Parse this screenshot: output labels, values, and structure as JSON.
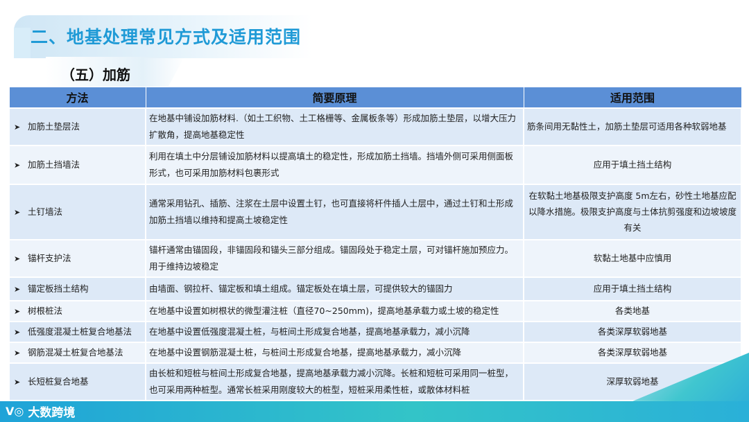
{
  "header": {
    "title": "二、地基处理常见方式及适用范围",
    "subtitle": "（五）加筋"
  },
  "table": {
    "columns": [
      "方法",
      "简要原理",
      "适用范围"
    ],
    "rows": [
      {
        "method": "加筋土垫层法",
        "principle": "在地基中铺设加筋材料.（如土工织物、土工格栅等、金属板条等）形成加筋土垫层，以增大压力扩散角，提高地基稳定性",
        "scope": "筋条间用无黏性土，加筋土垫层可适用各种软弱地基"
      },
      {
        "method": "加筋土挡墙法",
        "principle": "利用在填土中分层铺设加筋材料以提高填土的稳定性，形成加筋土挡墙。挡墙外侧可采用侧面板形式，也可采用加筋材料包裹形式",
        "scope": "应用于填土挡土结构"
      },
      {
        "method": "土钉墙法",
        "principle": "通常采用钻孔、插筋、注浆在土层中设置土钉，也可直接将杆件插人土层中，通过土钉和土形成加筋土挡墙以维持和提高土坡稳定性",
        "scope": "在软黏土地基极限支护高度 5m左右，砂性土地基应配以降水措施。极限支护高度与土体抗剪强度和边坡坡度有关"
      },
      {
        "method": "锚杆支护法",
        "principle": "锚杆通常由锚固段，非锚固段和锚头三部分组成。锚固段处于稳定土层，可对锚杆施加预应力。用于维持边坡稳定",
        "scope": "软黏土地基中应慎用"
      },
      {
        "method": "锚定板挡土结构",
        "principle": "由墙面、钢拉杆、锚定板和填土组成。锚定板处在填土层，可提供较大的锚固力",
        "scope": "应用于填土挡土结构"
      },
      {
        "method": "树根桩法",
        "principle": "在地基中设置如树根状的微型灌注桩（直径70~250mm)，提高地基承载力或土坡的稳定性",
        "scope": "各类地基"
      },
      {
        "method": "低强度混凝土桩复合地基法",
        "principle": "在地基中设置低强度混凝土桩，与桩间土形成复合地基，提高地基承载力，减小沉降",
        "scope": "各类深厚软弱地基"
      },
      {
        "method": "钢筋混凝土桩复合地基法",
        "principle": "在地基中设置钢筋混凝土桩，与桩间土形成复合地基，提高地基承载力，减小沉降",
        "scope": "各类深厚软弱地基"
      },
      {
        "method": "长短桩复合地基",
        "principle": "由长桩和短桩与桩间土形成复合地基，提高地基承载力减小沉降。长桩和短桩可采用同一桩型，也可采用两种桩型。通常长桩采用刚度较大的桩型，短桩采用柔性桩，或散体材料桩",
        "scope": "深厚软弱地基"
      }
    ]
  },
  "footer": {
    "logo_mark": "V◎",
    "logo_text": "大数跨境"
  },
  "colors": {
    "title": "#1f9ad6",
    "header_bg": "#5b8fd6",
    "row_bg": "#dde9f7",
    "footer": "#33c4c8"
  }
}
